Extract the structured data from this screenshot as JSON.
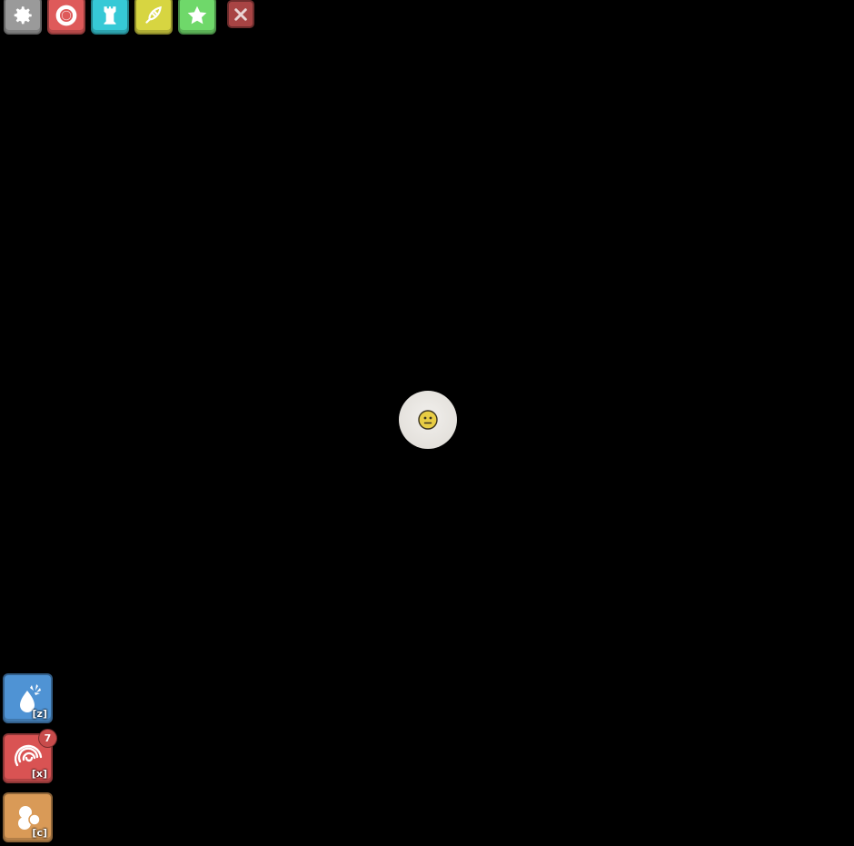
{
  "colors": {
    "background": "#000000",
    "settings": "#9a9a9a",
    "lifesaver": "#de5a5a",
    "tower": "#36c9d6",
    "rocket": "#d7d541",
    "star": "#6fd86a",
    "close": "#a84444",
    "ability_z": "#4f93d4",
    "ability_x": "#d95353",
    "ability_c": "#d99a57",
    "badge": "#c84b4b",
    "player_body": "#e6e3de",
    "player_face": "#e8cd44"
  },
  "toolbar": {
    "buttons": [
      {
        "icon": "gear-icon"
      },
      {
        "icon": "lifesaver-icon"
      },
      {
        "icon": "tower-icon"
      },
      {
        "icon": "rocket-icon"
      },
      {
        "icon": "star-icon"
      }
    ],
    "close": {
      "icon": "close-icon"
    }
  },
  "player": {
    "face_icon": "neutral-face-icon"
  },
  "abilities": [
    {
      "key": "[z]",
      "icon": "splash-icon"
    },
    {
      "key": "[x]",
      "icon": "vortex-icon",
      "charges": "7"
    },
    {
      "key": "[c]",
      "icon": "clone-icon"
    }
  ]
}
